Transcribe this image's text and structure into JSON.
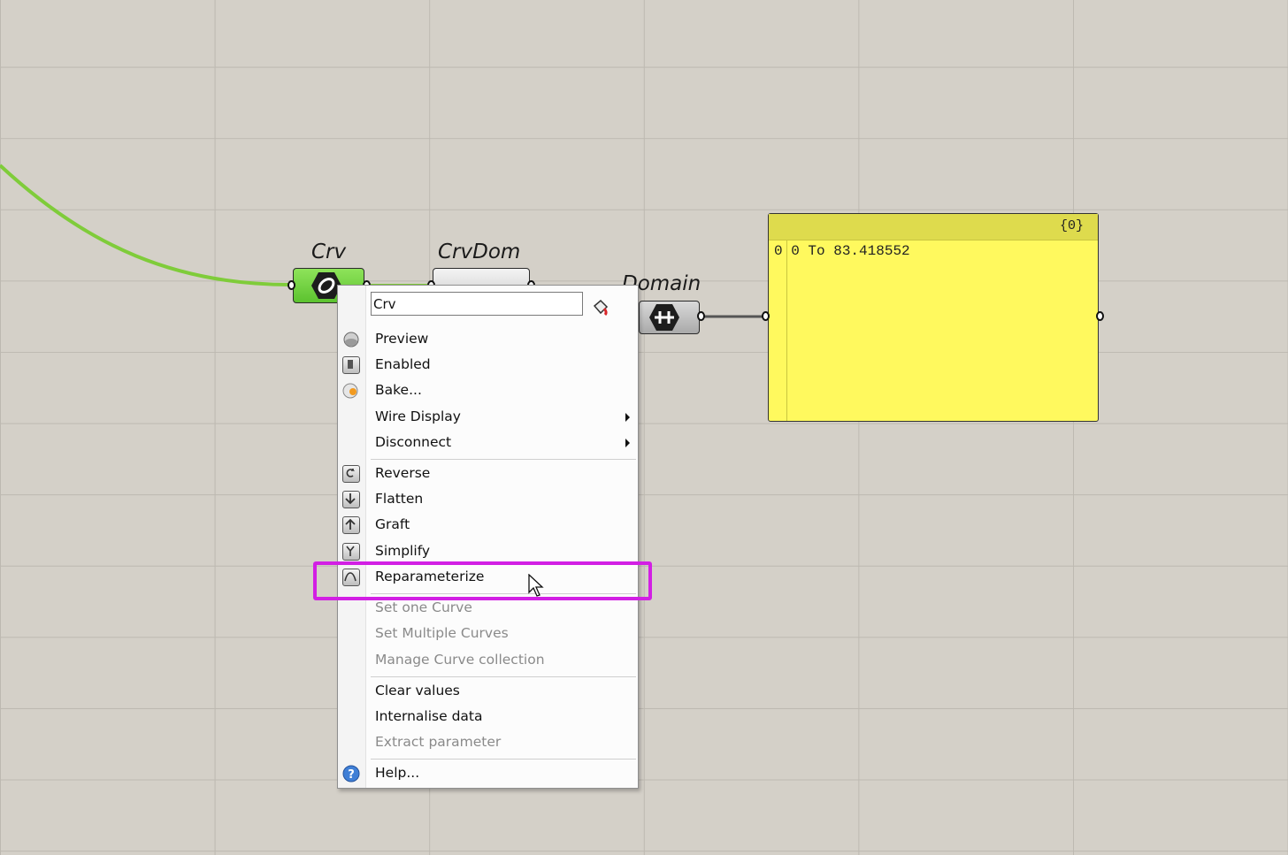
{
  "canvas": {
    "components": {
      "crv": {
        "label": "Crv"
      },
      "crvdom": {
        "label": "CrvDom"
      },
      "domain": {
        "label": "Domain"
      }
    },
    "panel": {
      "path": "{0}",
      "row_index": "0",
      "row_value": "0 To 83.418552"
    }
  },
  "context_menu": {
    "name_field": "Crv",
    "items": [
      {
        "label": "Preview",
        "icon": "preview-icon",
        "enabled": true
      },
      {
        "label": "Enabled",
        "icon": "enabled-icon",
        "enabled": true
      },
      {
        "label": "Bake...",
        "icon": "bake-icon",
        "enabled": true
      },
      {
        "label": "Wire Display",
        "submenu": true,
        "enabled": true
      },
      {
        "label": "Disconnect",
        "submenu": true,
        "enabled": true
      },
      {
        "label": "Reverse",
        "icon": "reverse-icon",
        "enabled": true
      },
      {
        "label": "Flatten",
        "icon": "flatten-icon",
        "enabled": true
      },
      {
        "label": "Graft",
        "icon": "graft-icon",
        "enabled": true
      },
      {
        "label": "Simplify",
        "icon": "simplify-icon",
        "enabled": true
      },
      {
        "label": "Reparameterize",
        "icon": "reparameterize-icon",
        "enabled": true,
        "highlighted": true
      },
      {
        "label": "Set one Curve",
        "enabled": false
      },
      {
        "label": "Set Multiple Curves",
        "enabled": false
      },
      {
        "label": "Manage Curve collection",
        "enabled": false
      },
      {
        "label": "Clear values",
        "enabled": true
      },
      {
        "label": "Internalise data",
        "enabled": true
      },
      {
        "label": "Extract parameter",
        "enabled": false
      },
      {
        "label": "Help...",
        "icon": "help-icon",
        "enabled": true
      }
    ]
  },
  "colors": {
    "highlight": "#d21fe4",
    "wire": "#7fcc3a",
    "panel": "#fff95e",
    "param_green": "#6fd23c"
  }
}
